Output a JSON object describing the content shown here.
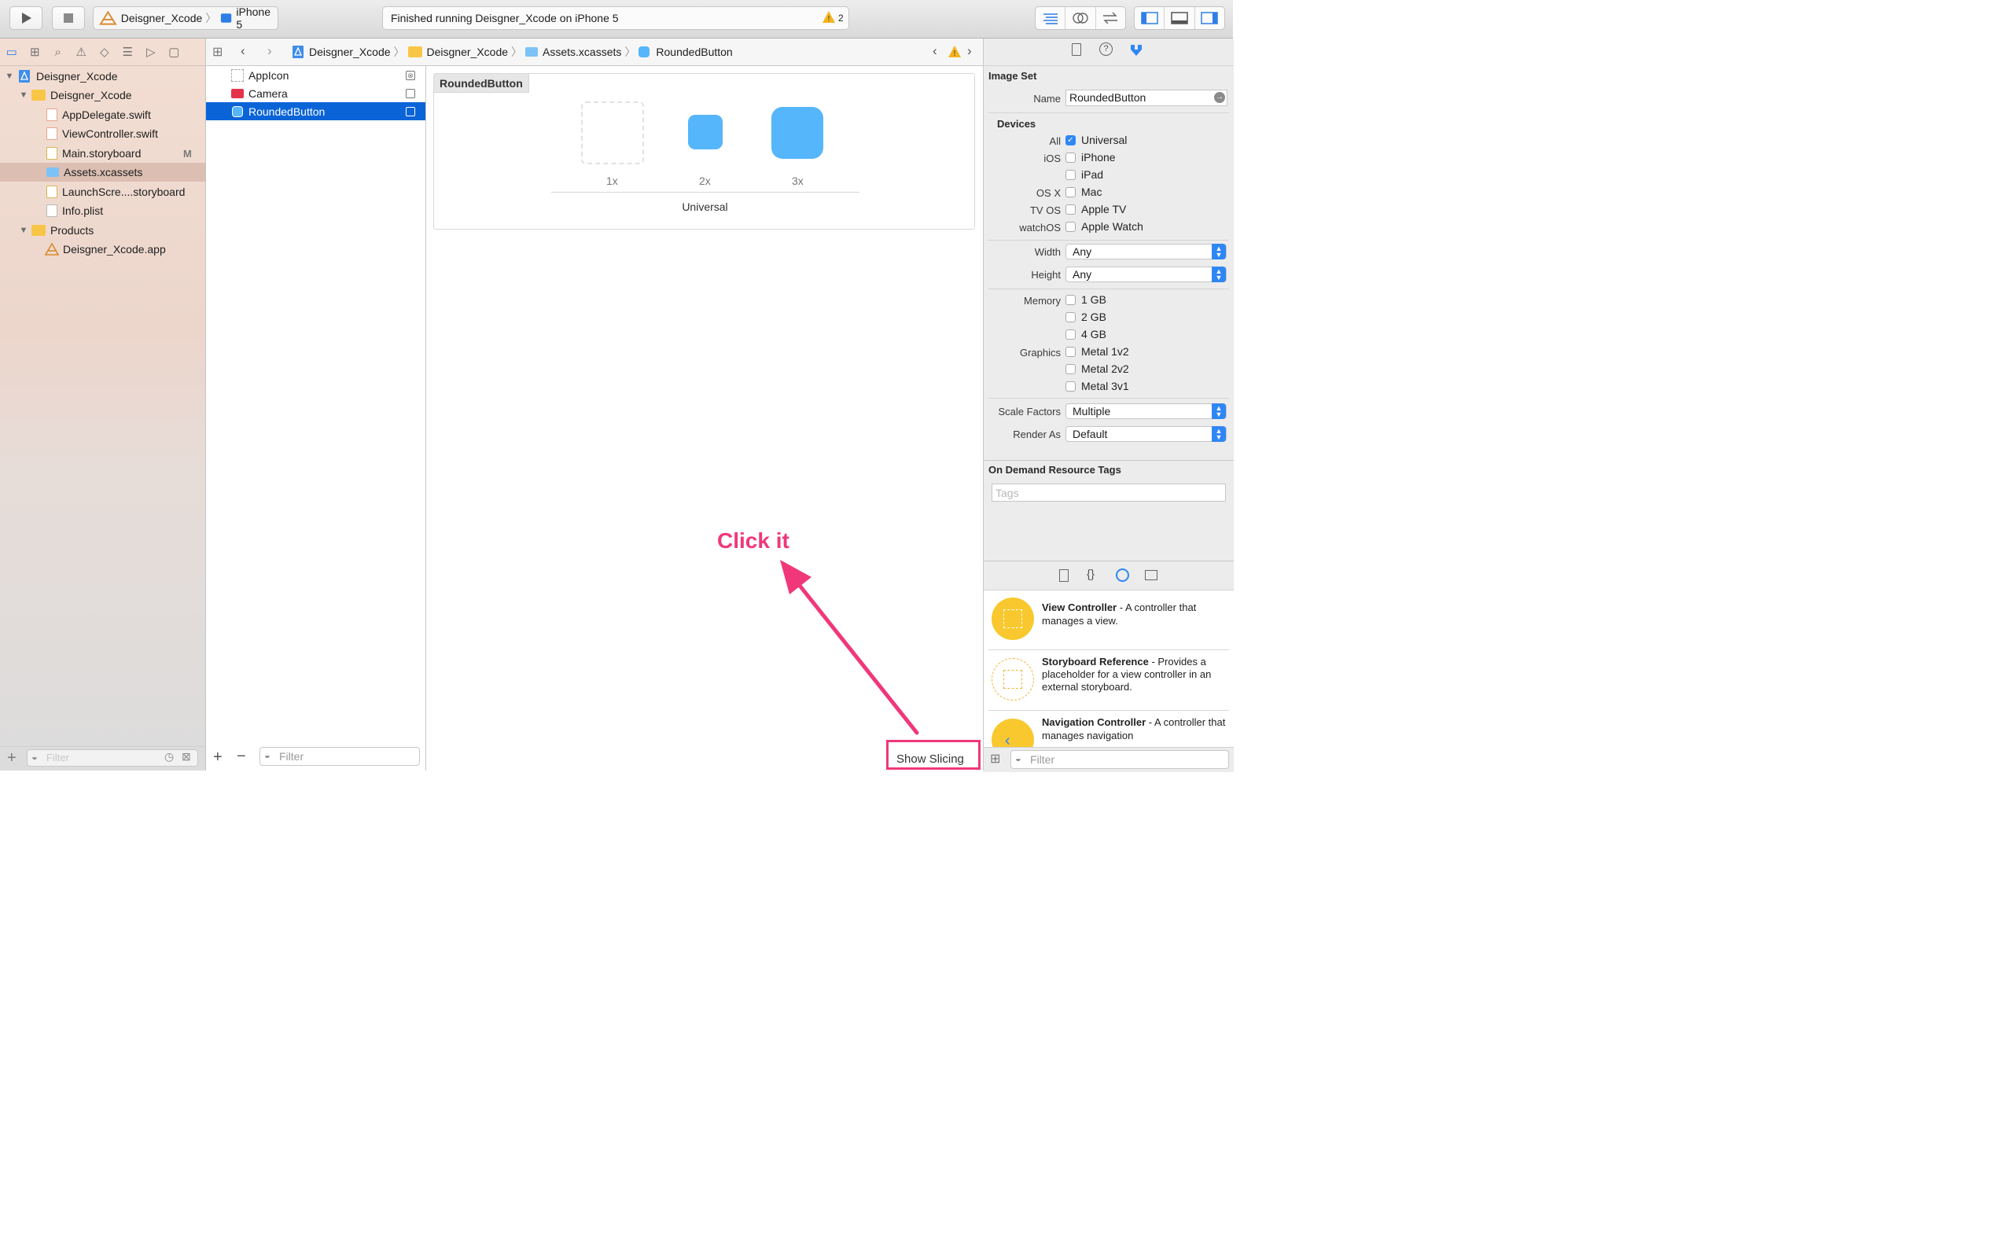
{
  "toolbar": {
    "scheme_target": "Deisgner_Xcode",
    "scheme_device": "iPhone 5",
    "status_text": "Finished running Deisgner_Xcode on iPhone 5",
    "warning_count": "2"
  },
  "navigator": {
    "items": [
      {
        "label": "Deisgner_Xcode"
      },
      {
        "label": "Deisgner_Xcode"
      },
      {
        "label": "AppDelegate.swift"
      },
      {
        "label": "ViewController.swift"
      },
      {
        "label": "Main.storyboard",
        "badge": "M"
      },
      {
        "label": "Assets.xcassets"
      },
      {
        "label": "LaunchScre....storyboard"
      },
      {
        "label": "Info.plist"
      },
      {
        "label": "Products"
      },
      {
        "label": "Deisgner_Xcode.app"
      }
    ],
    "filter_placeholder": "Filter"
  },
  "jumpbar": {
    "crumbs": [
      "Deisgner_Xcode",
      "Deisgner_Xcode",
      "Assets.xcassets",
      "RoundedButton"
    ]
  },
  "asset_list": {
    "items": [
      {
        "label": "AppIcon"
      },
      {
        "label": "Camera"
      },
      {
        "label": "RoundedButton"
      }
    ],
    "filter_placeholder": "Filter"
  },
  "canvas": {
    "asset_title": "RoundedButton",
    "slots": [
      "1x",
      "2x",
      "3x"
    ],
    "group_label": "Universal",
    "show_slicing": "Show Slicing",
    "annotation": "Click it",
    "accent_color": "#55b6fb",
    "annotation_color": "#f0377a"
  },
  "inspector": {
    "section_title": "Image Set",
    "name_label": "Name",
    "name_value": "RoundedButton",
    "devices_title": "Devices",
    "device_rows": [
      {
        "platform": "All",
        "label": "Universal",
        "checked": true
      },
      {
        "platform": "iOS",
        "label": "iPhone",
        "checked": false
      },
      {
        "platform": "",
        "label": "iPad",
        "checked": false
      },
      {
        "platform": "OS X",
        "label": "Mac",
        "checked": false
      },
      {
        "platform": "TV OS",
        "label": "Apple TV",
        "checked": false
      },
      {
        "platform": "watchOS",
        "label": "Apple Watch",
        "checked": false
      }
    ],
    "width_label": "Width",
    "width_value": "Any",
    "height_label": "Height",
    "height_value": "Any",
    "memory_label": "Memory",
    "memory_options": [
      "1 GB",
      "2 GB",
      "4 GB"
    ],
    "graphics_label": "Graphics",
    "graphics_options": [
      "Metal 1v2",
      "Metal 2v2",
      "Metal 3v1"
    ],
    "scale_label": "Scale Factors",
    "scale_value": "Multiple",
    "render_label": "Render As",
    "render_value": "Default",
    "odr_title": "On Demand Resource Tags",
    "tags_placeholder": "Tags"
  },
  "library": {
    "items": [
      {
        "title": "View Controller",
        "desc": " - A controller that manages a view."
      },
      {
        "title": "Storyboard Reference",
        "desc": " - Provides a placeholder for a view controller in an external storyboard."
      },
      {
        "title": "Navigation Controller",
        "desc": " - A controller that manages navigation"
      }
    ],
    "filter_placeholder": "Filter"
  }
}
